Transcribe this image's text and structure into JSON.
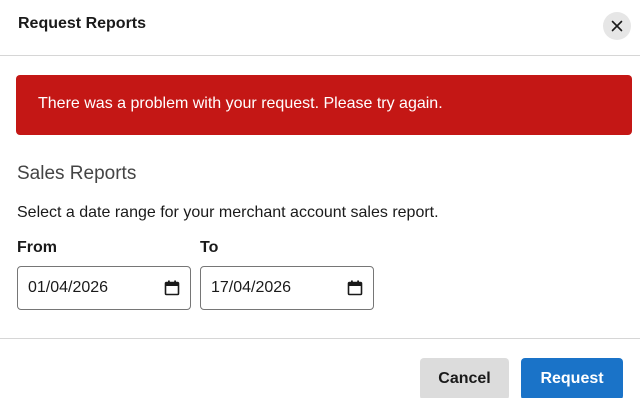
{
  "dialog": {
    "title": "Request Reports",
    "close_icon": "close-icon"
  },
  "error": {
    "message": "There was a problem with your request. Please try again.",
    "color": "#c41715"
  },
  "section": {
    "title": "Sales Reports",
    "description": "Select a date range for your merchant account sales report."
  },
  "from": {
    "label": "From",
    "value": "01/04/2026",
    "icon": "calendar-icon"
  },
  "to": {
    "label": "To",
    "value": "17/04/2026",
    "icon": "calendar-icon"
  },
  "footer": {
    "cancel_label": "Cancel",
    "request_label": "Request",
    "request_color": "#1a73c8"
  }
}
